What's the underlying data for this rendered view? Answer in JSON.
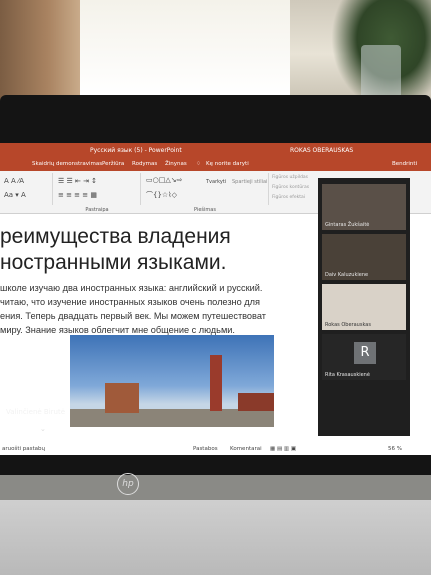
{
  "app": {
    "title": "Русский язык (5) - PowerPoint",
    "user_name": "ROKAS OBERAUSKAS",
    "share_label": "Bendrinti",
    "tabs": [
      "Skaidrių demonstravimas",
      "Peržiūra",
      "Rodymas",
      "Žinynas"
    ],
    "tell_me": "Kę norite daryti",
    "ribbon_groups": [
      "Pastraipa",
      "Piešimas"
    ],
    "ribbon_items": {
      "arrange": "Tvarkyti",
      "quick_styles": "Spartieji stiliai",
      "fill": "Figūros užpildas",
      "outline": "Figūros kontūras",
      "effects": "Figūros efektai"
    }
  },
  "slide": {
    "title_line1": "реимущества владения",
    "title_line2": "ностранными языками.",
    "paragraph_lines": [
      "школе изучаю два иностранных языка: английский и русский.",
      "читаю, что изучение иностранных языков очень полезно для",
      "ения. Теперь двадцать первый век. Мы можем путешествоват",
      "миру. Знание языков облегчит мне общение с людьми."
    ]
  },
  "notes_label": "aruošti pastabų",
  "status": {
    "notes_button": "Pastabos",
    "comments_button": "Komentarai",
    "zoom": "56 %"
  },
  "zoom_panel": {
    "participants": [
      {
        "name": "Gintaras Žukšaitė"
      },
      {
        "name": "Daiv Kaluzukiene"
      },
      {
        "name": "Rokas Oberauskas"
      },
      {
        "name": "Rita Krasauskienė",
        "initial": "R"
      }
    ],
    "active_speaker": "Valinčienė Birutė"
  },
  "brand": "hp"
}
